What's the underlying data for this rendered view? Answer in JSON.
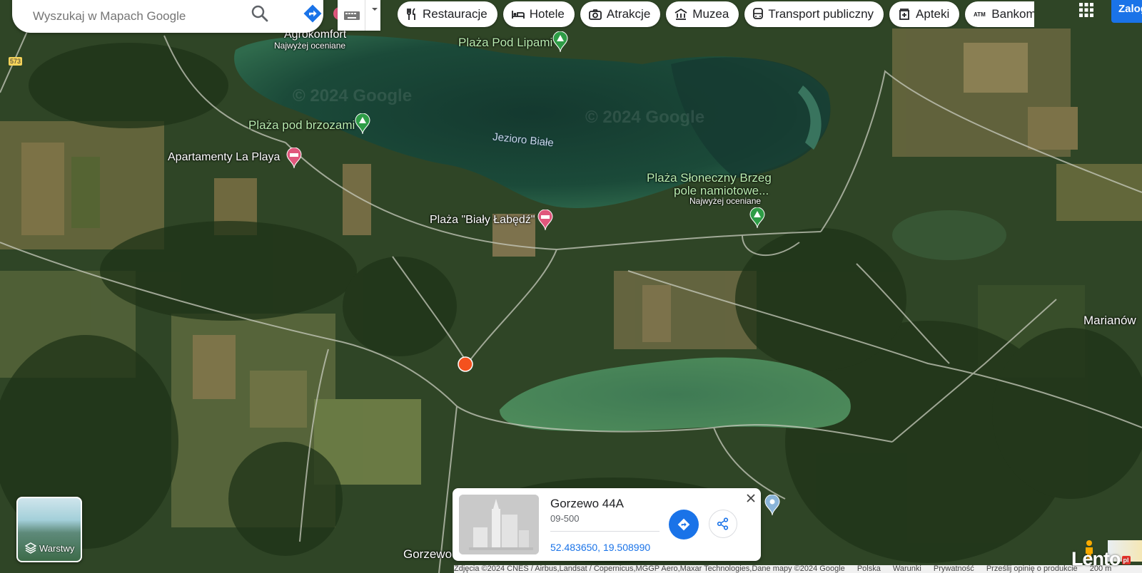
{
  "search": {
    "placeholder": "Wyszukaj w Mapach Google"
  },
  "chips": [
    {
      "label": "Restauracje",
      "icon": "fork-knife-icon"
    },
    {
      "label": "Hotele",
      "icon": "bed-icon"
    },
    {
      "label": "Atrakcje",
      "icon": "camera-icon"
    },
    {
      "label": "Muzea",
      "icon": "museum-icon"
    },
    {
      "label": "Transport publiczny",
      "icon": "bus-icon"
    },
    {
      "label": "Apteki",
      "icon": "pharmacy-icon"
    },
    {
      "label": "Bankomaty",
      "icon": "atm-icon"
    }
  ],
  "header": {
    "login_label": "Zaloguj się"
  },
  "map": {
    "labels": {
      "agrokomfort": "Agrokomfort",
      "agrokomfort_sub": "Najwyżej oceniane",
      "plaza_pod_lipami": "Plaża Pod Lipami",
      "plaza_pod_brzozami": "Plaża pod brzozami",
      "apartamenty": "Apartamenty La Playa",
      "jezioro": "Jezioro Białe",
      "plaza_sloneczny_1": "Plaża Słoneczny Brzeg",
      "plaza_sloneczny_2": "pole namiotowe...",
      "plaza_sloneczny_sub": "Najwyżej oceniane",
      "bialy_labedz": "Plaża \"Biały Łabędź\"",
      "marianow": "Marianów",
      "gorzewo": "Gorzewo",
      "road": "573"
    },
    "watermark": "© 2024 Google"
  },
  "layers": {
    "label": "Warstwy"
  },
  "card": {
    "title": "Gorzewo 44A",
    "postal": "09-500",
    "coords": "52.483650, 19.508990"
  },
  "footer": {
    "attribution": "Zdjęcia ©2024 CNES / Airbus,Landsat / Copernicus,MGGP Aero,Maxar Technologies,Dane mapy ©2024 Google",
    "country": "Polska",
    "terms": "Warunki",
    "privacy": "Prywatność",
    "feedback": "Prześlij opinię o produkcie",
    "scale": "200 m"
  },
  "watermark_site": {
    "name": "Lento",
    "badge": "pl"
  },
  "colors": {
    "accent": "#1a73e8",
    "pin_green": "#2e9c46",
    "pin_pink": "#e0577d",
    "marker": "#f4511e"
  }
}
